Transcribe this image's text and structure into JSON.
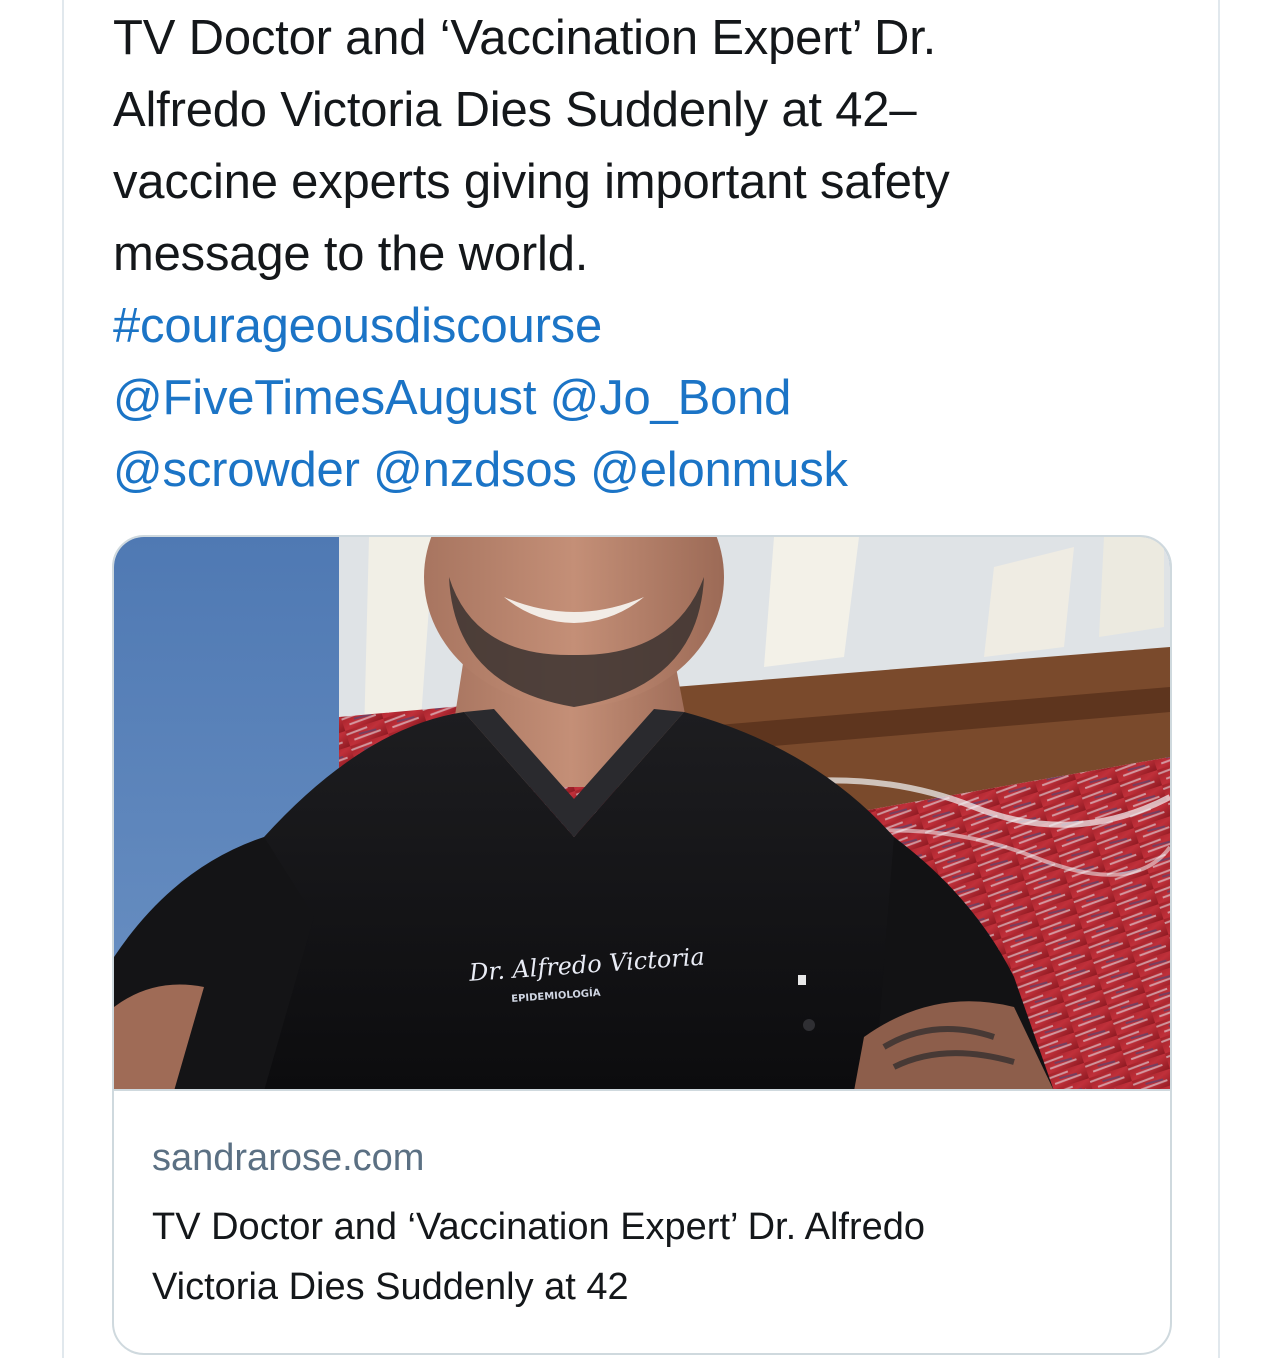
{
  "tweet": {
    "text_lines": [
      "TV Doctor and ‘Vaccination Expert’ Dr.",
      "Alfredo Victoria Dies Suddenly at 42–",
      "vaccine experts giving important safety",
      "message to the world."
    ],
    "hashtag": "#courageousdiscourse",
    "mentions": [
      "@FiveTimesAugust",
      "@Jo_Bond",
      "@scrowder",
      "@nzdsos",
      "@elonmusk"
    ]
  },
  "link_card": {
    "image": {
      "shirt_logo_text": "Dr. Alfredo Victoria",
      "shirt_logo_subtext": "EPIDEMIOLOGÍA"
    },
    "domain": "sandrarose.com",
    "title_lines": [
      "TV Doctor and ‘Vaccination Expert’ Dr. Alfredo",
      "Victoria Dies Suddenly at 42"
    ]
  },
  "colors": {
    "link": "#1b74c6",
    "text": "#14171a",
    "secondary_text": "#5b7083",
    "border": "#cfd9de"
  }
}
